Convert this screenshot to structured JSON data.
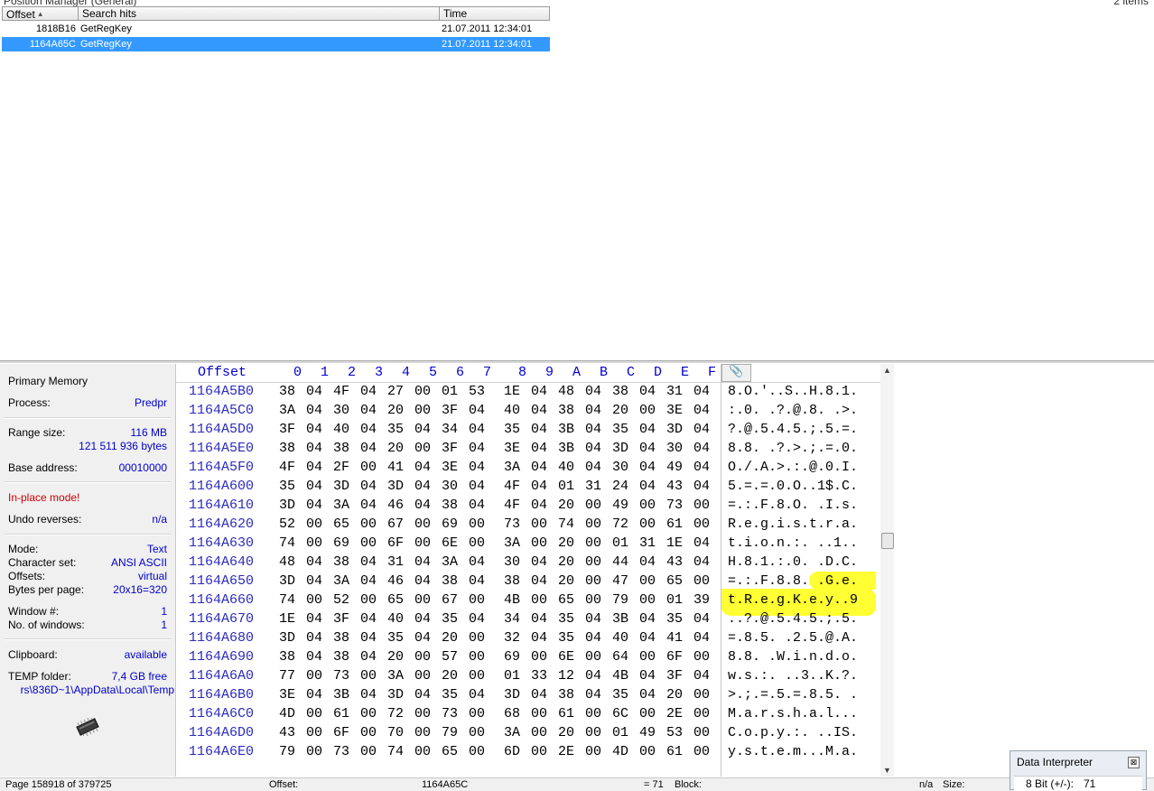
{
  "position_manager": {
    "title": "Position Manager (General)",
    "count": "2 items",
    "columns": {
      "offset": "Offset",
      "hits": "Search hits",
      "time": "Time"
    },
    "rows": [
      {
        "offset": "1818B16",
        "hit": "GetRegKey",
        "time": "21.07.2011  12:34:01"
      },
      {
        "offset": "1164A65C",
        "hit": "GetRegKey",
        "time": "21.07.2011  12:34:01"
      }
    ]
  },
  "info": {
    "primary_memory": "Primary Memory",
    "process_label": "Process:",
    "process_value": "Predpr",
    "range_label": "Range size:",
    "range_value": "116 MB",
    "range_bytes": "121 511 936 bytes",
    "base_label": "Base address:",
    "base_value": "00010000",
    "inplace": "In-place mode!",
    "undo_label": "Undo reverses:",
    "undo_value": "n/a",
    "mode_label": "Mode:",
    "mode_value": "Text",
    "charset_label": "Character set:",
    "charset_value": "ANSI ASCII",
    "offsets_label": "Offsets:",
    "offsets_value": "virtual",
    "bpp_label": "Bytes per page:",
    "bpp_value": "20x16=320",
    "window_label": "Window #:",
    "window_value": "1",
    "nwin_label": "No. of windows:",
    "nwin_value": "1",
    "clip_label": "Clipboard:",
    "clip_value": "available",
    "temp_label": "TEMP folder:",
    "temp_value": "7,4 GB free",
    "temp_path": "rs\\836D~1\\AppData\\Local\\Temp"
  },
  "hex": {
    "offset_header": "Offset",
    "columns": [
      "0",
      "1",
      "2",
      "3",
      "4",
      "5",
      "6",
      "7",
      "8",
      "9",
      "A",
      "B",
      "C",
      "D",
      "E",
      "F"
    ],
    "rows": [
      {
        "off": "1164A5B0",
        "bytes": [
          "38",
          "04",
          "4F",
          "04",
          "27",
          "00",
          "01",
          "53",
          "1E",
          "04",
          "48",
          "04",
          "38",
          "04",
          "31",
          "04"
        ],
        "ascii": "8.O.'..S..H.8.1."
      },
      {
        "off": "1164A5C0",
        "bytes": [
          "3A",
          "04",
          "30",
          "04",
          "20",
          "00",
          "3F",
          "04",
          "40",
          "04",
          "38",
          "04",
          "20",
          "00",
          "3E",
          "04"
        ],
        "ascii": ":.0. .?.@.8. .>."
      },
      {
        "off": "1164A5D0",
        "bytes": [
          "3F",
          "04",
          "40",
          "04",
          "35",
          "04",
          "34",
          "04",
          "35",
          "04",
          "3B",
          "04",
          "35",
          "04",
          "3D",
          "04"
        ],
        "ascii": "?.@.5.4.5.;.5.=."
      },
      {
        "off": "1164A5E0",
        "bytes": [
          "38",
          "04",
          "38",
          "04",
          "20",
          "00",
          "3F",
          "04",
          "3E",
          "04",
          "3B",
          "04",
          "3D",
          "04",
          "30",
          "04"
        ],
        "ascii": "8.8. .?.>.;.=.0."
      },
      {
        "off": "1164A5F0",
        "bytes": [
          "4F",
          "04",
          "2F",
          "00",
          "41",
          "04",
          "3E",
          "04",
          "3A",
          "04",
          "40",
          "04",
          "30",
          "04",
          "49",
          "04"
        ],
        "ascii": "O./.A.>.:.@.0.I."
      },
      {
        "off": "1164A600",
        "bytes": [
          "35",
          "04",
          "3D",
          "04",
          "3D",
          "04",
          "30",
          "04",
          "4F",
          "04",
          "01",
          "31",
          "24",
          "04",
          "43",
          "04"
        ],
        "ascii": "5.=.=.0.O..1$.C."
      },
      {
        "off": "1164A610",
        "bytes": [
          "3D",
          "04",
          "3A",
          "04",
          "46",
          "04",
          "38",
          "04",
          "4F",
          "04",
          "20",
          "00",
          "49",
          "00",
          "73",
          "00"
        ],
        "ascii": "=.:.F.8.O. .I.s."
      },
      {
        "off": "1164A620",
        "bytes": [
          "52",
          "00",
          "65",
          "00",
          "67",
          "00",
          "69",
          "00",
          "73",
          "00",
          "74",
          "00",
          "72",
          "00",
          "61",
          "00"
        ],
        "ascii": "R.e.g.i.s.t.r.a."
      },
      {
        "off": "1164A630",
        "bytes": [
          "74",
          "00",
          "69",
          "00",
          "6F",
          "00",
          "6E",
          "00",
          "3A",
          "00",
          "20",
          "00",
          "01",
          "31",
          "1E",
          "04"
        ],
        "ascii": "t.i.o.n.:. ..1.."
      },
      {
        "off": "1164A640",
        "bytes": [
          "48",
          "04",
          "38",
          "04",
          "31",
          "04",
          "3A",
          "04",
          "30",
          "04",
          "20",
          "00",
          "44",
          "04",
          "43",
          "04"
        ],
        "ascii": "H.8.1.:.0. .D.C."
      },
      {
        "off": "1164A650",
        "bytes": [
          "3D",
          "04",
          "3A",
          "04",
          "46",
          "04",
          "38",
          "04",
          "38",
          "04",
          "20",
          "00",
          "47",
          "00",
          "65",
          "00"
        ],
        "ascii": "=.:.F.8.8. .G.e."
      },
      {
        "off": "1164A660",
        "bytes": [
          "74",
          "00",
          "52",
          "00",
          "65",
          "00",
          "67",
          "00",
          "4B",
          "00",
          "65",
          "00",
          "79",
          "00",
          "01",
          "39"
        ],
        "ascii": "t.R.e.g.K.e.y..9"
      },
      {
        "off": "1164A670",
        "bytes": [
          "1E",
          "04",
          "3F",
          "04",
          "40",
          "04",
          "35",
          "04",
          "34",
          "04",
          "35",
          "04",
          "3B",
          "04",
          "35",
          "04"
        ],
        "ascii": "..?.@.5.4.5.;.5."
      },
      {
        "off": "1164A680",
        "bytes": [
          "3D",
          "04",
          "38",
          "04",
          "35",
          "04",
          "20",
          "00",
          "32",
          "04",
          "35",
          "04",
          "40",
          "04",
          "41",
          "04"
        ],
        "ascii": "=.8.5. .2.5.@.A."
      },
      {
        "off": "1164A690",
        "bytes": [
          "38",
          "04",
          "38",
          "04",
          "20",
          "00",
          "57",
          "00",
          "69",
          "00",
          "6E",
          "00",
          "64",
          "00",
          "6F",
          "00"
        ],
        "ascii": "8.8. .W.i.n.d.o."
      },
      {
        "off": "1164A6A0",
        "bytes": [
          "77",
          "00",
          "73",
          "00",
          "3A",
          "00",
          "20",
          "00",
          "01",
          "33",
          "12",
          "04",
          "4B",
          "04",
          "3F",
          "04"
        ],
        "ascii": "w.s.:. ..3..K.?."
      },
      {
        "off": "1164A6B0",
        "bytes": [
          "3E",
          "04",
          "3B",
          "04",
          "3D",
          "04",
          "35",
          "04",
          "3D",
          "04",
          "38",
          "04",
          "35",
          "04",
          "20",
          "00"
        ],
        "ascii": ">.;.=.5.=.8.5. ."
      },
      {
        "off": "1164A6C0",
        "bytes": [
          "4D",
          "00",
          "61",
          "00",
          "72",
          "00",
          "73",
          "00",
          "68",
          "00",
          "61",
          "00",
          "6C",
          "00",
          "2E",
          "00"
        ],
        "ascii": "M.a.r.s.h.a.l..."
      },
      {
        "off": "1164A6D0",
        "bytes": [
          "43",
          "00",
          "6F",
          "00",
          "70",
          "00",
          "79",
          "00",
          "3A",
          "00",
          "20",
          "00",
          "01",
          "49",
          "53",
          "00"
        ],
        "ascii": "C.o.p.y.:. ..IS."
      },
      {
        "off": "1164A6E0",
        "bytes": [
          "79",
          "00",
          "73",
          "00",
          "74",
          "00",
          "65",
          "00",
          "6D",
          "00",
          "2E",
          "00",
          "4D",
          "00",
          "61",
          "00"
        ],
        "ascii": "y.s.t.e.m...M.a."
      }
    ]
  },
  "status": {
    "page": "Page 158918 of 379725",
    "offset_label": "Offset:",
    "offset_value": "1164A65C",
    "eq": "= 71",
    "block_label": "Block:",
    "na": "n/a",
    "size_label": "Size:"
  },
  "interpreter": {
    "title": "Data Interpreter",
    "label": "8 Bit (+/-):",
    "value": "71"
  }
}
